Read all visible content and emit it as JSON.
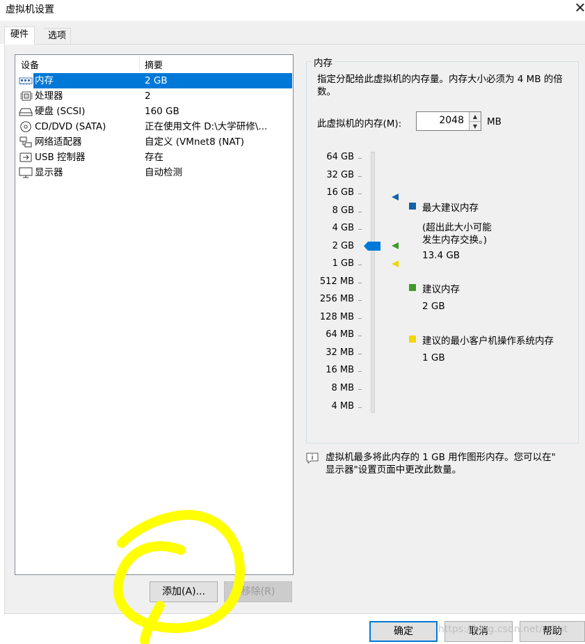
{
  "window": {
    "title": "虚拟机设置",
    "close_glyph": "✕"
  },
  "tabs": [
    {
      "label": "硬件",
      "selected": true
    },
    {
      "label": "选项",
      "selected": false
    }
  ],
  "device_list": {
    "columns": [
      "设备",
      "摘要"
    ],
    "rows": [
      {
        "icon": "memory-icon",
        "name": "内存",
        "summary": "2 GB",
        "selected": true
      },
      {
        "icon": "processor-icon",
        "name": "处理器",
        "summary": "2",
        "selected": false
      },
      {
        "icon": "hard-disk-icon",
        "name": "硬盘 (SCSI)",
        "summary": "160 GB",
        "selected": false
      },
      {
        "icon": "cd-dvd-icon",
        "name": "CD/DVD (SATA)",
        "summary": "正在使用文件 D:\\大学研修\\...",
        "selected": false
      },
      {
        "icon": "network-adapter-icon",
        "name": "网络适配器",
        "summary": "自定义 (VMnet8 (NAT)",
        "selected": false
      },
      {
        "icon": "usb-icon",
        "name": "USB 控制器",
        "summary": "存在",
        "selected": false
      },
      {
        "icon": "display-icon",
        "name": "显示器",
        "summary": "自动检测",
        "selected": false
      }
    ]
  },
  "list_buttons": {
    "add": "添加(A)...",
    "remove": "移除(R)"
  },
  "memory": {
    "group_title": "内存",
    "description": "指定分配给此虚拟机的内存量。内存大小必须为 4 MB 的倍数。",
    "field_label": "此虚拟机的内存(M):",
    "value": "2048",
    "unit": "MB",
    "scale_labels": [
      "64 GB",
      "32 GB",
      "16 GB",
      "8 GB",
      "4 GB",
      "2 GB",
      "1 GB",
      "512 MB",
      "256 MB",
      "128 MB",
      "64 MB",
      "32 MB",
      "16 MB",
      "8 MB",
      "4 MB"
    ],
    "slider_level": "2 GB",
    "legend": {
      "max": {
        "title": "最大建议内存",
        "note_line1": "(超出此大小可能",
        "note_line2": "发生内存交换。)",
        "value": "13.4 GB",
        "color": "#1560a8"
      },
      "recommended": {
        "title": "建议内存",
        "value": "2 GB",
        "color": "#3e9a2a"
      },
      "min_guest": {
        "title": "建议的最小客户机操作系统内存",
        "value": "1 GB",
        "color": "#f2d600"
      }
    },
    "info_line1": "虚拟机最多将此内存的 1 GB 用作图形内存。您可以在\"",
    "info_line2": "显示器\"设置页面中更改此数量。"
  },
  "dialog_buttons": {
    "ok": "确定",
    "cancel": "取消",
    "help": "帮助"
  },
  "watermark": "https://blog.csdn.net/...hot",
  "colors": {
    "selection": "#0078d7",
    "highlight_annotation": "#ffff00"
  }
}
